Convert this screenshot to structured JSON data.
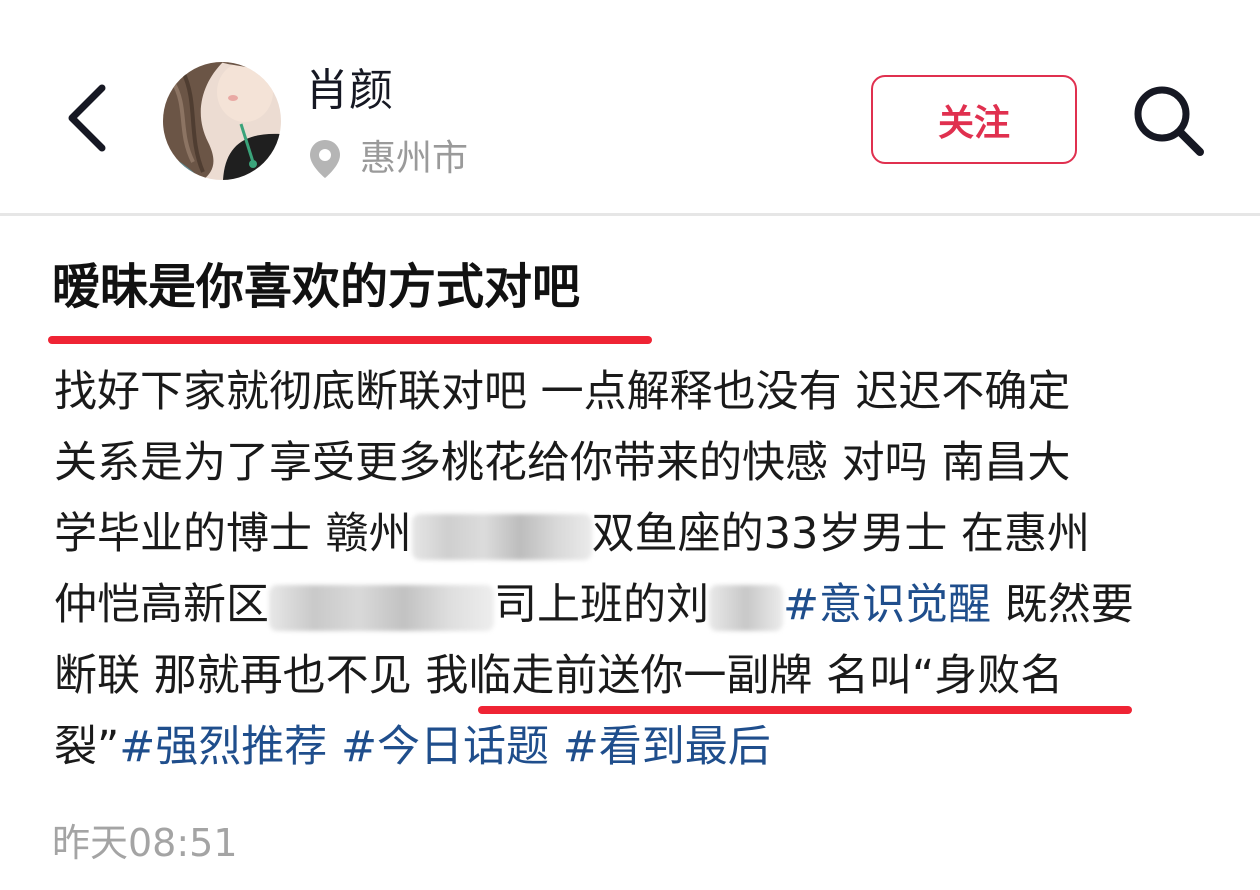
{
  "header": {
    "author_name": "肖颜",
    "location": "惠州市",
    "follow_label": "关注"
  },
  "post": {
    "title": "暧昧是你喜欢的方式对吧",
    "lines": {
      "l1": "找好下家就彻底断联对吧 一点解释也没有 迟迟不确定",
      "l2": "关系是为了享受更多桃花给你带来的快感 对吗 南昌大",
      "l3_a": "学毕业的博士 赣州",
      "l3_b": "双鱼座的33岁男士 在惠州",
      "l4_a": "仲恺高新区",
      "l4_b": "司上班的刘",
      "l4_tag": "#意识觉醒",
      "l4_c": " 既然要",
      "l5": "断联 那就再也不见 我临走前送你一副牌 名叫“身败名",
      "l6_a": "裂”",
      "tag_1": "#强烈推荐",
      "tag_2": "#今日话题",
      "tag_3": "#看到最后"
    },
    "timestamp": "昨天08:51"
  },
  "colors": {
    "accent_red": "#ef2434",
    "follow_red": "#e0304f",
    "hashtag_blue": "#1f4e8c",
    "muted_gray": "#9a9a9a"
  },
  "icons": [
    "back-arrow-icon",
    "avatar-illustration",
    "location-pin-icon",
    "search-icon"
  ]
}
